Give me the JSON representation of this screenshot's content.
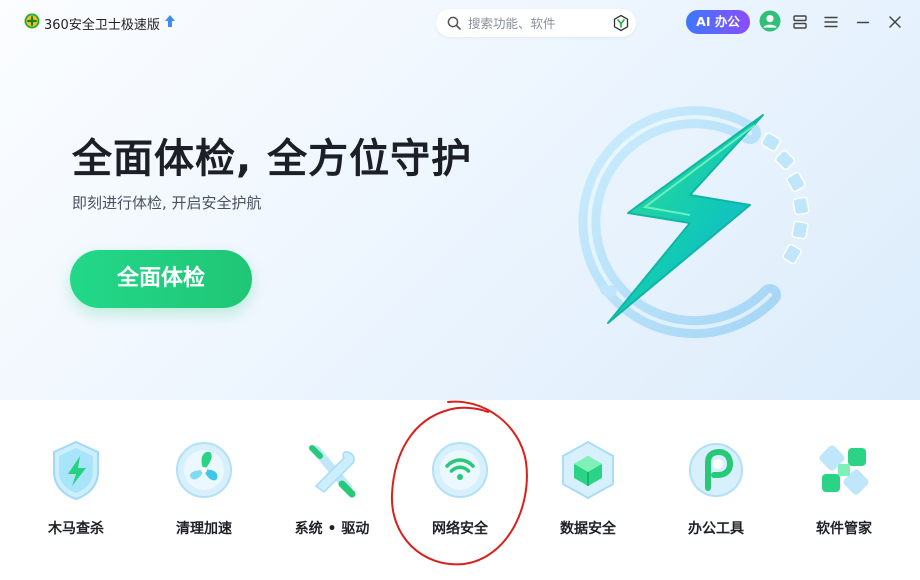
{
  "app": {
    "name": "360安全卫士极速版"
  },
  "search": {
    "placeholder": "搜索功能、软件"
  },
  "header": {
    "ai_label": "AI 办公"
  },
  "hero": {
    "title": "全面体检, 全方位守护",
    "subtitle": "即刻进行体检, 开启安全护航",
    "button_label": "全面体检"
  },
  "tools": [
    {
      "label": "木马查杀",
      "icon": "shield-bolt-icon"
    },
    {
      "label": "清理加速",
      "icon": "fan-icon"
    },
    {
      "label": "系统 • 驱动",
      "icon": "wrench-screwdriver-icon"
    },
    {
      "label": "网络安全",
      "icon": "wifi-icon"
    },
    {
      "label": "数据安全",
      "icon": "data-cube-icon"
    },
    {
      "label": "办公工具",
      "icon": "office-p-icon"
    },
    {
      "label": "软件管家",
      "icon": "app-grid-icon"
    }
  ],
  "colors": {
    "accent_green": "#1fc675",
    "ai_gradient_start": "#3c78ff",
    "ai_gradient_end": "#8a4dff",
    "annotation_red": "#d9201c"
  }
}
